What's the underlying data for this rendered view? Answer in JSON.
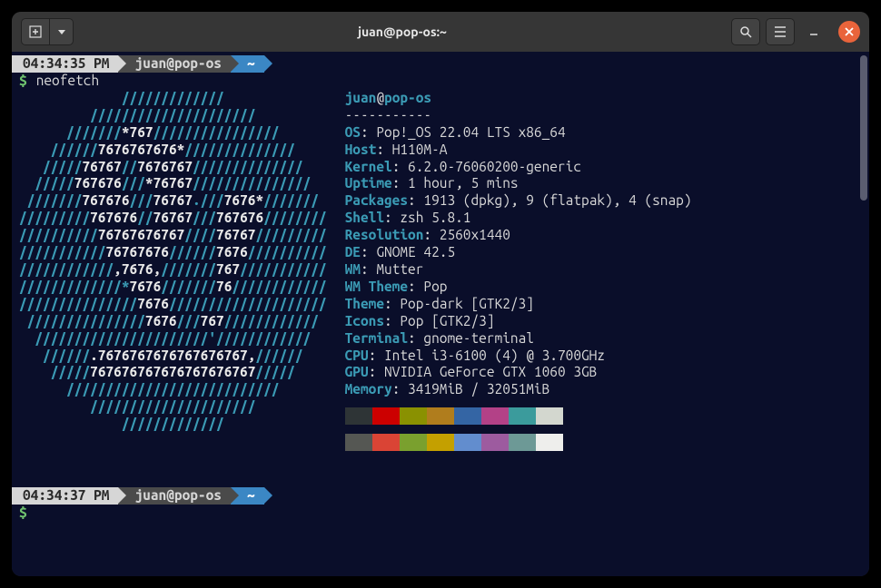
{
  "window": {
    "title": "juan@pop-os:~"
  },
  "prompt1": {
    "time": "04:34:35 PM",
    "host": "juan@pop-os",
    "path": "~"
  },
  "command": "neofetch",
  "prompt_symbol": "$",
  "ascii": [
    {
      "indent": "             ",
      "parts": [
        {
          "t": "slash",
          "s": "/////////////"
        }
      ]
    },
    {
      "indent": "         ",
      "parts": [
        {
          "t": "slash",
          "s": "/////////////////////"
        }
      ]
    },
    {
      "indent": "      ",
      "parts": [
        {
          "t": "slash",
          "s": "///////"
        },
        {
          "t": "num",
          "s": "*767"
        },
        {
          "t": "slash",
          "s": "////////////////"
        }
      ]
    },
    {
      "indent": "    ",
      "parts": [
        {
          "t": "slash",
          "s": "//////"
        },
        {
          "t": "num",
          "s": "7676767676*"
        },
        {
          "t": "slash",
          "s": "//////////////"
        }
      ]
    },
    {
      "indent": "   ",
      "parts": [
        {
          "t": "slash",
          "s": "/////"
        },
        {
          "t": "num",
          "s": "76767"
        },
        {
          "t": "slash",
          "s": "//"
        },
        {
          "t": "num",
          "s": "7676767"
        },
        {
          "t": "slash",
          "s": "//////////////"
        }
      ]
    },
    {
      "indent": "  ",
      "parts": [
        {
          "t": "slash",
          "s": "/////"
        },
        {
          "t": "num",
          "s": "767676"
        },
        {
          "t": "slash",
          "s": "///"
        },
        {
          "t": "num",
          "s": "*76767"
        },
        {
          "t": "slash",
          "s": "///////////////"
        }
      ]
    },
    {
      "indent": " ",
      "parts": [
        {
          "t": "slash",
          "s": "///////"
        },
        {
          "t": "num",
          "s": "767676"
        },
        {
          "t": "slash",
          "s": "///"
        },
        {
          "t": "num",
          "s": "76767"
        },
        {
          "t": "slash",
          "s": ".///"
        },
        {
          "t": "num",
          "s": "7676*"
        },
        {
          "t": "slash",
          "s": "///////"
        }
      ]
    },
    {
      "indent": "",
      "parts": [
        {
          "t": "slash",
          "s": "/////////"
        },
        {
          "t": "num",
          "s": "767676"
        },
        {
          "t": "slash",
          "s": "//"
        },
        {
          "t": "num",
          "s": "76767"
        },
        {
          "t": "slash",
          "s": "///"
        },
        {
          "t": "num",
          "s": "767676"
        },
        {
          "t": "slash",
          "s": "////////"
        }
      ]
    },
    {
      "indent": "",
      "parts": [
        {
          "t": "slash",
          "s": "//////////"
        },
        {
          "t": "num",
          "s": "76767676767"
        },
        {
          "t": "slash",
          "s": "////"
        },
        {
          "t": "num",
          "s": "76767"
        },
        {
          "t": "slash",
          "s": "/////////"
        }
      ]
    },
    {
      "indent": "",
      "parts": [
        {
          "t": "slash",
          "s": "///////////"
        },
        {
          "t": "num",
          "s": "76767676"
        },
        {
          "t": "slash",
          "s": "//////"
        },
        {
          "t": "num",
          "s": "7676"
        },
        {
          "t": "slash",
          "s": "//////////"
        }
      ]
    },
    {
      "indent": "",
      "parts": [
        {
          "t": "slash",
          "s": "////////////"
        },
        {
          "t": "num",
          "s": ","
        },
        {
          "t": "num",
          "s": "7676"
        },
        {
          "t": "num",
          "s": ","
        },
        {
          "t": "slash",
          "s": "///////"
        },
        {
          "t": "num",
          "s": "767"
        },
        {
          "t": "slash",
          "s": "///////////"
        }
      ]
    },
    {
      "indent": "",
      "parts": [
        {
          "t": "slash",
          "s": "/////////////*"
        },
        {
          "t": "num",
          "s": "7676"
        },
        {
          "t": "slash",
          "s": "///////"
        },
        {
          "t": "num",
          "s": "76"
        },
        {
          "t": "slash",
          "s": "////////////"
        }
      ]
    },
    {
      "indent": "",
      "parts": [
        {
          "t": "slash",
          "s": "///////////////"
        },
        {
          "t": "num",
          "s": "7676"
        },
        {
          "t": "slash",
          "s": "////////////////////"
        }
      ]
    },
    {
      "indent": " ",
      "parts": [
        {
          "t": "slash",
          "s": "///////////////"
        },
        {
          "t": "num",
          "s": "7676"
        },
        {
          "t": "slash",
          "s": "///"
        },
        {
          "t": "num",
          "s": "767"
        },
        {
          "t": "slash",
          "s": "////////////"
        }
      ]
    },
    {
      "indent": "  ",
      "parts": [
        {
          "t": "slash",
          "s": "//////////////////////'"
        },
        {
          "t": "slash",
          "s": "////////////"
        }
      ]
    },
    {
      "indent": "   ",
      "parts": [
        {
          "t": "slash",
          "s": "//////"
        },
        {
          "t": "num",
          "s": ".7676767676767676767,"
        },
        {
          "t": "slash",
          "s": "//////"
        }
      ]
    },
    {
      "indent": "    ",
      "parts": [
        {
          "t": "slash",
          "s": "/////"
        },
        {
          "t": "num",
          "s": "767676767676767676767"
        },
        {
          "t": "slash",
          "s": "/////"
        }
      ]
    },
    {
      "indent": "      ",
      "parts": [
        {
          "t": "slash",
          "s": "///////////////////////////"
        }
      ]
    },
    {
      "indent": "         ",
      "parts": [
        {
          "t": "slash",
          "s": "/////////////////////"
        }
      ]
    },
    {
      "indent": "             ",
      "parts": [
        {
          "t": "slash",
          "s": "/////////////"
        }
      ]
    }
  ],
  "neofetch": {
    "user": "juan",
    "at": "@",
    "hostname": "pop-os",
    "dashes": "-----------",
    "rows": [
      {
        "key": "OS",
        "val": ": Pop!_OS 22.04 LTS x86_64"
      },
      {
        "key": "Host",
        "val": ": H110M-A"
      },
      {
        "key": "Kernel",
        "val": ": 6.2.0-76060200-generic"
      },
      {
        "key": "Uptime",
        "val": ": 1 hour, 5 mins"
      },
      {
        "key": "Packages",
        "val": ": 1913 (dpkg), 9 (flatpak), 4 (snap)"
      },
      {
        "key": "Shell",
        "val": ": zsh 5.8.1"
      },
      {
        "key": "Resolution",
        "val": ": 2560x1440"
      },
      {
        "key": "DE",
        "val": ": GNOME 42.5"
      },
      {
        "key": "WM",
        "val": ": Mutter"
      },
      {
        "key": "WM Theme",
        "val": ": Pop"
      },
      {
        "key": "Theme",
        "val": ": Pop-dark [GTK2/3]"
      },
      {
        "key": "Icons",
        "val": ": Pop [GTK2/3]"
      },
      {
        "key": "Terminal",
        "val": ": gnome-terminal"
      },
      {
        "key": "CPU",
        "val": ": Intel i3-6100 (4) @ 3.700GHz"
      },
      {
        "key": "GPU",
        "val": ": NVIDIA GeForce GTX 1060 3GB"
      },
      {
        "key": "Memory",
        "val": ": 3419MiB / 32051MiB"
      }
    ]
  },
  "colors": {
    "row1": [
      "#2e3436",
      "#cc0000",
      "#8a9101",
      "#b07d1d",
      "#3465a4",
      "#b34187",
      "#3b9b9c",
      "#d3d7cf"
    ],
    "row2": [
      "#555753",
      "#da4435",
      "#7aa02e",
      "#c4a000",
      "#628dce",
      "#9d5b9f",
      "#6d9996",
      "#eeeeec"
    ]
  },
  "prompt2": {
    "time": "04:34:37 PM",
    "host": "juan@pop-os",
    "path": "~"
  }
}
